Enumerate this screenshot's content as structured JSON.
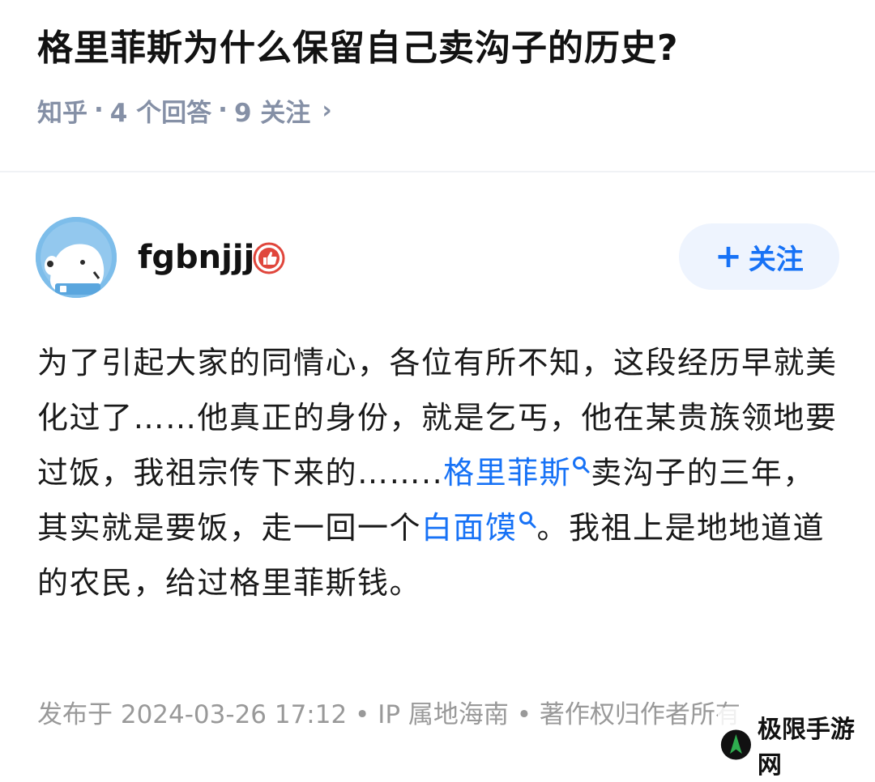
{
  "question": {
    "title": "格里菲斯为什么保留自己卖沟子的历史?",
    "source": "知乎",
    "answers": "4 个回答",
    "followers": "9 关注",
    "sep": "·",
    "chevron": "›"
  },
  "answer": {
    "author": {
      "name": "fgbnjjj",
      "follow_plus": "+",
      "follow_label": "关注"
    },
    "content": {
      "seg1": "为了引起大家的同情心，各位有所不知，这段经历早就美化过了……他真正的身份，就是乞丐，他在某贵族领地要过饭，我祖宗传下来的……..",
      "link1": "格里菲斯",
      "seg2": "卖沟子的三年，其实就是要饭，走一回一个",
      "link2": "白面馍",
      "seg3": "。我祖上是地地道道的农民，给过格里菲斯钱。"
    },
    "footer": "发布于 2024-03-26 17:12 • IP 属地海南 • 著作权归作者所有"
  },
  "watermark": {
    "text": "极限手游网"
  },
  "colors": {
    "link": "#1772f6",
    "meta": "#8590a6",
    "follow_bg": "#eef4fe"
  }
}
